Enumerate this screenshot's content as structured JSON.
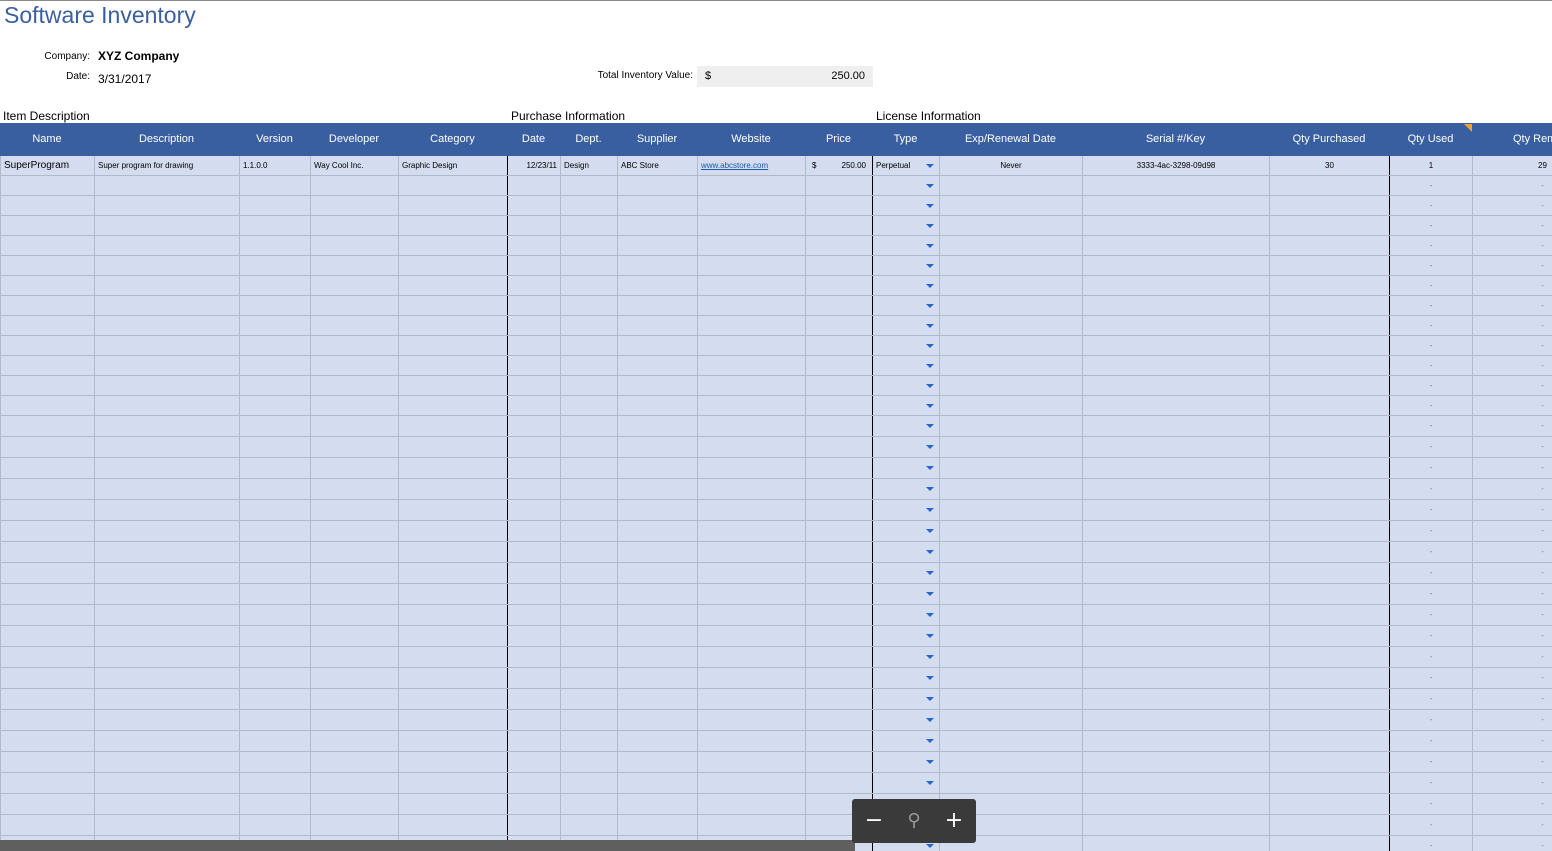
{
  "title": "Software Inventory",
  "company_label": "Company:",
  "company": "XYZ Company",
  "date_label": "Date:",
  "date": "3/31/2017",
  "total_label": "Total Inventory Value:",
  "total_currency": "$",
  "total_value": "250.00",
  "sections": {
    "item": "Item Description",
    "purchase": "Purchase Information",
    "license": "License Information"
  },
  "columns": [
    "Name",
    "Description",
    "Version",
    "Developer",
    "Category",
    "Date",
    "Dept.",
    "Supplier",
    "Website",
    "Price",
    "Type",
    "Exp/Renewal Date",
    "Serial #/Key",
    "Qty Purchased",
    "Qty Used",
    "Qty Remain"
  ],
  "rows": [
    {
      "name": "SuperProgram",
      "description": "Super program for drawing",
      "version": "1.1.0.0",
      "developer": "Way Cool Inc.",
      "category": "Graphic Design",
      "date": "12/23/11",
      "dept": "Design",
      "supplier": "ABC Store",
      "website": "www.abcstore.com",
      "price_currency": "$",
      "price": "250.00",
      "type": "Perpetual",
      "exp": "Never",
      "serial": "3333-4ac-3298-09d98",
      "qty_purchased": "30",
      "qty_used": "1",
      "qty_remain": "29"
    }
  ],
  "empty_placeholder": "-",
  "zoom": {
    "minus": "−",
    "reset": "⚲",
    "plus": "+"
  },
  "icons": {
    "dropdown": "triangle-down-icon",
    "zoom_reset": "magnifier-icon"
  }
}
